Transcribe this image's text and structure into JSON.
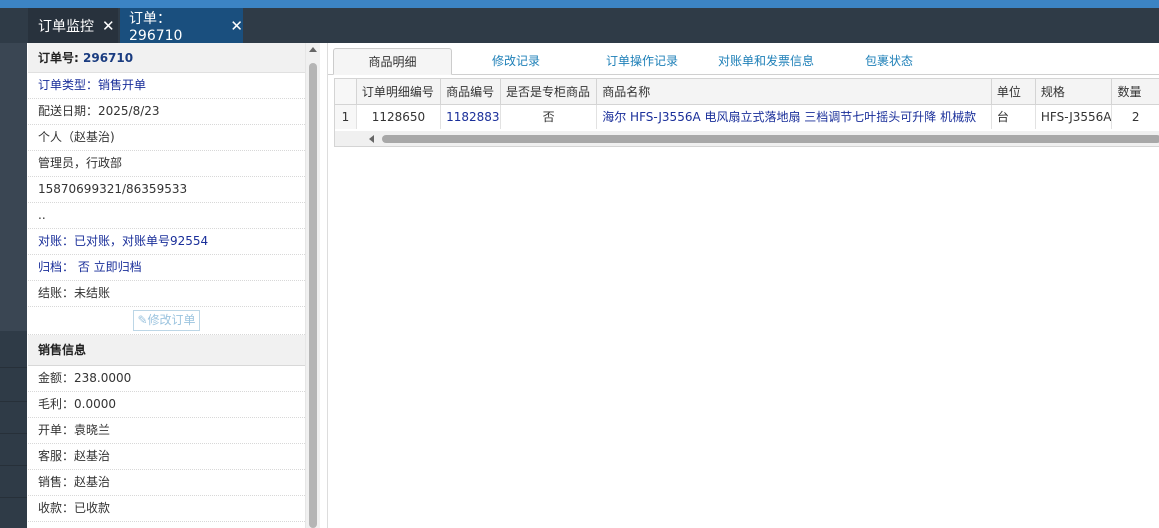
{
  "tabs": [
    {
      "label": "订单监控",
      "close": "✕"
    },
    {
      "label": "订单：296710",
      "close": "✕"
    }
  ],
  "order": {
    "number_label": "订单号:",
    "number_value": "296710",
    "type": "订单类型：销售开单",
    "delivery_date": "配送日期：2025/8/23",
    "customer": "个人（赵基治)",
    "org": "管理员，行政部",
    "phone": "15870699321/86359533",
    "dots": "..",
    "reconcile": "对账：已对账，对账单号92554",
    "archive": "归档： 否 立即归档",
    "settle": "结账：未结账",
    "edit_button": "修改订单"
  },
  "sales": {
    "section_title": "销售信息",
    "amount": "金额：238.0000",
    "gross_profit": "毛利：0.0000",
    "opened_by": "开单：袁晓兰",
    "service": "客服：赵基治",
    "seller": "销售：赵基治",
    "payment": "收款：已收款"
  },
  "panel_tabs": [
    "商品明细",
    "修改记录",
    "订单操作记录",
    "对账单和发票信息",
    "包裹状态"
  ],
  "grid": {
    "columns": [
      "订单明细编号",
      "商品编号",
      "是否是专柜商品",
      "商品名称",
      "单位",
      "规格",
      "数量"
    ],
    "rows": [
      {
        "row": "1",
        "detail_id": "1128650",
        "product_id": "1182883",
        "counter": "否",
        "name": "海尔 HFS-J3556A 电风扇立式落地扇 三档调节七叶摇头可升降 机械款",
        "unit": "台",
        "spec": "HFS-J3556A",
        "qty": "2"
      }
    ]
  },
  "colors": {
    "accent": "#3c84c4",
    "tab_active": "#1a4f7e",
    "nav": "#2f3b47",
    "link": "#1a2f9a"
  }
}
